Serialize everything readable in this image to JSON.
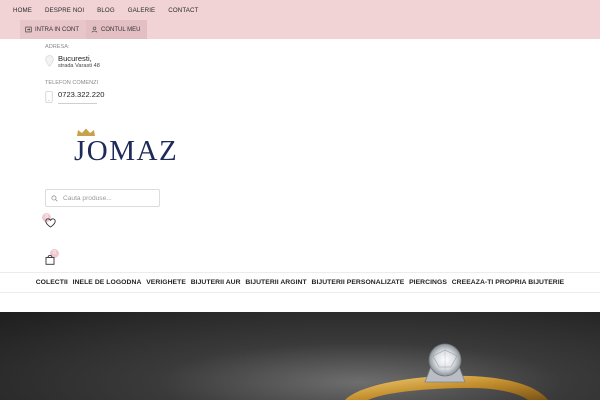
{
  "topnav": [
    "HOME",
    "DESPRE NOI",
    "BLOG",
    "GALERIE",
    "CONTACT"
  ],
  "account": {
    "login": "INTRA IN CONT",
    "my_account": "CONTUL MEU"
  },
  "contact": {
    "address_label": "ADRESA:",
    "address_city": "Bucuresti,",
    "address_street": "strada Varasti 48",
    "phone_label": "TELEFON COMENZI",
    "phone": "0723.322.220"
  },
  "logo": {
    "text": "JOMAZ"
  },
  "search": {
    "placeholder": "Cauta produse..."
  },
  "wishlist": {
    "count": "0"
  },
  "cart": {
    "count": "0"
  },
  "mainnav": [
    "COLECTII",
    "INELE DE LOGODNA",
    "VERIGHETE",
    "BIJUTERII AUR",
    "BIJUTERII ARGINT",
    "BIJUTERII PERSONALIZATE",
    "PIERCINGS",
    "CREEAZA-TI PROPRIA BIJUTERIE"
  ],
  "colors": {
    "topbar": "#f1d3d6",
    "brand": "#1d2a5a",
    "crown": "#c9a14a",
    "accent": "#efc9cd"
  }
}
